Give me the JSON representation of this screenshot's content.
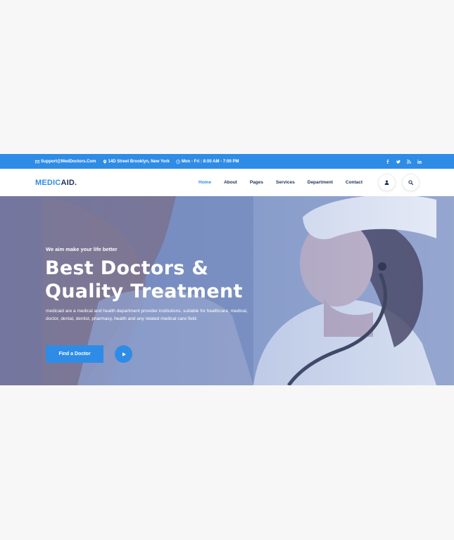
{
  "topbar": {
    "email": "Support@MedDoctors.Com",
    "address": "14D Street Brooklyn, New York",
    "hours": "Mon - Fri : 8:00 AM - 7:00 PM",
    "social": [
      "f",
      "twitter",
      "rss",
      "in"
    ]
  },
  "brand": {
    "part1": "MEDIC",
    "part2": "AID."
  },
  "nav": {
    "items": [
      "Home",
      "About",
      "Pages",
      "Services",
      "Department",
      "Contact"
    ],
    "active": "Home"
  },
  "hero": {
    "subtitle": "We aim make your life better",
    "title_line1": "Best Doctors &",
    "title_highlight": "Quality",
    "title_rest": " Treatment",
    "description": "medicaid are a medical and health department provider institutions. suitable for healthcare, medical, doctor, dental, dentist, pharmacy, health and any related medical care field.",
    "cta": "Find a Doctor"
  },
  "colors": {
    "accent": "#2f8ce6",
    "navy": "#1c2f5a"
  }
}
